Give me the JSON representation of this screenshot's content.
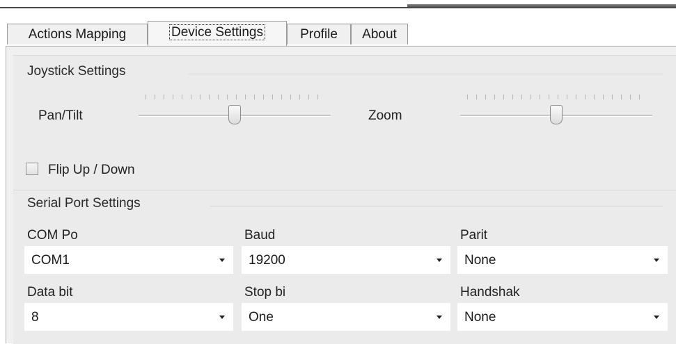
{
  "tabs": [
    {
      "label": "Actions Mapping",
      "active": false
    },
    {
      "label": "Device Settings",
      "active": true
    },
    {
      "label": "Profile",
      "active": false
    },
    {
      "label": "About",
      "active": false
    }
  ],
  "joystick": {
    "title": "Joystick Settings",
    "pan_tilt_label": "Pan/Tilt",
    "pan_tilt_level": 0.5,
    "zoom_label": "Zoom",
    "zoom_level": 0.5,
    "flip_label": "Flip Up / Down",
    "flip_checked": false
  },
  "serial": {
    "title": "Serial Port Settings",
    "fields": [
      {
        "label": "COM Po",
        "value": "COM1"
      },
      {
        "label": "Baud",
        "value": "19200"
      },
      {
        "label": "Parit",
        "value": "None"
      },
      {
        "label": "Data bit",
        "value": "8"
      },
      {
        "label": "Stop bi",
        "value": "One"
      },
      {
        "label": "Handshak",
        "value": "None"
      }
    ]
  },
  "colors": {
    "panel_bg": "#f0f0f0",
    "group_bg": "#ebebeb",
    "select_bg": "#ffffff",
    "text": "#1a1a1a"
  }
}
